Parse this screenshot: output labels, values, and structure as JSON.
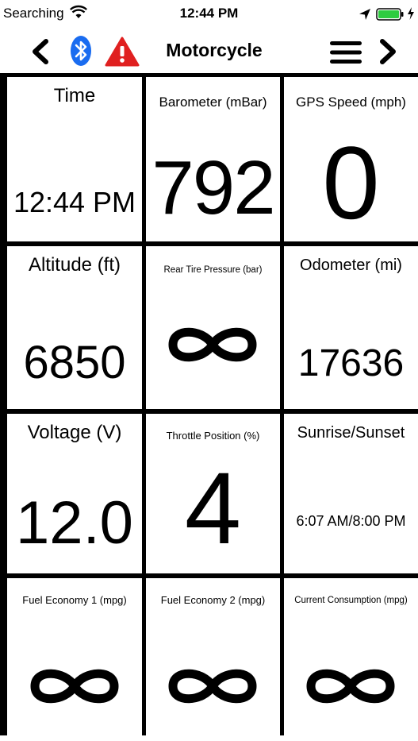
{
  "status_bar": {
    "carrier": "Searching",
    "time": "12:44 PM"
  },
  "nav": {
    "title": "Motorcycle",
    "icons": [
      "chevron-left-icon",
      "bluetooth-icon",
      "warning-icon",
      "menu-icon",
      "chevron-right-icon"
    ]
  },
  "colors": {
    "bluetooth": "#1a6cf0",
    "warning": "#e02020"
  },
  "tiles": [
    {
      "label": "Time",
      "value": "12:44 PM"
    },
    {
      "label": "Barometer (mBar)",
      "value": "792"
    },
    {
      "label": "GPS Speed (mph)",
      "value": "0"
    },
    {
      "label": "Altitude (ft)",
      "value": "6850"
    },
    {
      "label": "Rear Tire Pressure (bar)",
      "value": "∞"
    },
    {
      "label": "Odometer (mi)",
      "value": "17636"
    },
    {
      "label": "Voltage (V)",
      "value": "12.0"
    },
    {
      "label": "Throttle Position (%)",
      "value": "4"
    },
    {
      "label": "Sunrise/Sunset",
      "value": "6:07 AM/8:00 PM"
    },
    {
      "label": "Fuel Economy 1 (mpg)",
      "value": "∞"
    },
    {
      "label": "Fuel Economy 2 (mpg)",
      "value": "∞"
    },
    {
      "label": "Current Consumption (mpg)",
      "value": "∞"
    }
  ]
}
